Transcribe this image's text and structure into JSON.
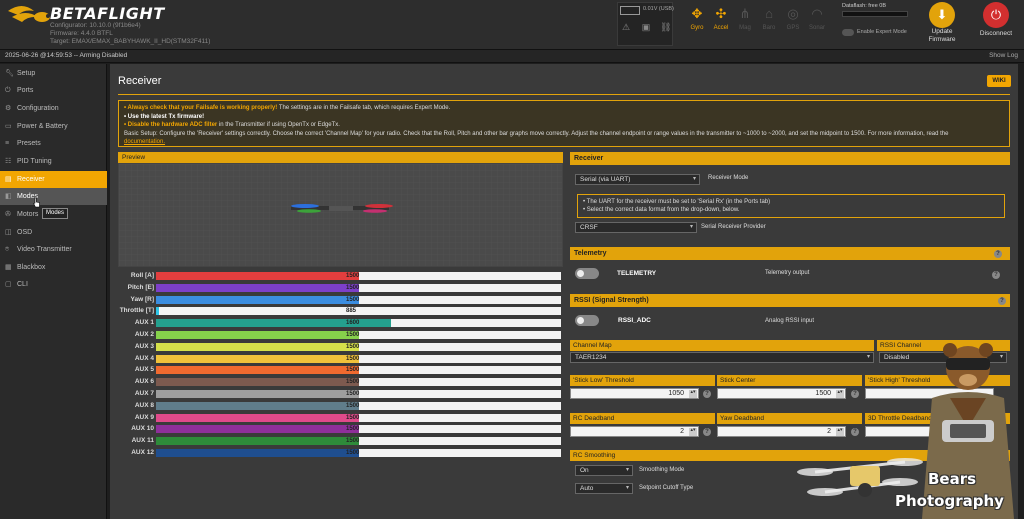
{
  "header": {
    "brand": "BETAFLIGHT",
    "configurator": "Configurator: 10.10.0 (9f1b6e4)",
    "firmware": "Firmware: 4.4.0 BTFL",
    "target": "Target: EMAX/EMAX_BABYHAWK_II_HD(STM32F411)",
    "battery_value": "0.01V (USB)",
    "sensors": [
      {
        "name": "Gyro",
        "icon": "gyro-icon",
        "active": true
      },
      {
        "name": "Accel",
        "icon": "accel-icon",
        "active": true
      },
      {
        "name": "Mag",
        "icon": "mag-icon",
        "active": false
      },
      {
        "name": "Baro",
        "icon": "baro-icon",
        "active": false
      },
      {
        "name": "GPS",
        "icon": "gps-icon",
        "active": false
      },
      {
        "name": "Sonar",
        "icon": "sonar-icon",
        "active": false
      }
    ],
    "dataflash": "Dataflash: free 0B",
    "expert_mode_label": "Enable Expert Mode",
    "update_firmware_label": "Update Firmware",
    "disconnect_label": "Disconnect"
  },
  "statusbar": {
    "text": "2025-06-26 @14:59:53 -- Arming Disabled",
    "show_log": "Show Log"
  },
  "sidebar": {
    "items": [
      {
        "label": "Setup",
        "icon": "wrench-icon"
      },
      {
        "label": "Ports",
        "icon": "plug-icon"
      },
      {
        "label": "Configuration",
        "icon": "gear-icon"
      },
      {
        "label": "Power & Battery",
        "icon": "battery-icon"
      },
      {
        "label": "Presets",
        "icon": "presets-icon"
      },
      {
        "label": "PID Tuning",
        "icon": "sliders-icon"
      },
      {
        "label": "Receiver",
        "icon": "receiver-icon"
      },
      {
        "label": "Modes",
        "icon": "modes-icon"
      },
      {
        "label": "Motors",
        "icon": "motor-icon"
      },
      {
        "label": "OSD",
        "icon": "osd-icon"
      },
      {
        "label": "Video Transmitter",
        "icon": "vtx-icon"
      },
      {
        "label": "Blackbox",
        "icon": "blackbox-icon"
      },
      {
        "label": "CLI",
        "icon": "terminal-icon"
      }
    ],
    "active": "Receiver",
    "hovered": "Modes",
    "tooltip": "Modes"
  },
  "main": {
    "title": "Receiver",
    "wiki": "WIKI",
    "note": {
      "l1_bold": "• Always check that your Failsafe is working properly!",
      "l1_rest": " The settings are in the Failsafe tab, which requires Expert Mode.",
      "l2": "• Use the latest Tx firmware!",
      "l3_bold": "• Disable the hardware ADC filter",
      "l3_rest": " in the Transmitter if using OpenTx or EdgeTx.",
      "l4": "Basic Setup: Configure the 'Receiver' settings correctly. Choose the correct 'Channel Map' for your radio. Check that the Roll, Pitch and other bar graphs move correctly. Adjust the channel endpoint or range values in the transmitter to ~1000 to ~2000, and set the midpoint to 1500. For more information, read the",
      "l5": "documentation."
    },
    "preview_title": "Preview",
    "channels": [
      {
        "name": "Roll [A]",
        "value": 1500,
        "color": "#e23e3e"
      },
      {
        "name": "Pitch [E]",
        "value": 1500,
        "color": "#7d3fc9"
      },
      {
        "name": "Yaw [R]",
        "value": 1500,
        "color": "#3b8de0"
      },
      {
        "name": "Throttle [T]",
        "value": 885,
        "color": "#2fc6e8"
      },
      {
        "name": "AUX 1",
        "value": 1600,
        "color": "#24a08e"
      },
      {
        "name": "AUX 2",
        "value": 1500,
        "color": "#86d14b"
      },
      {
        "name": "AUX 3",
        "value": 1500,
        "color": "#d5e04a"
      },
      {
        "name": "AUX 4",
        "value": 1500,
        "color": "#f0c23a"
      },
      {
        "name": "AUX 5",
        "value": 1500,
        "color": "#f06a2f"
      },
      {
        "name": "AUX 6",
        "value": 1500,
        "color": "#7d5a4f"
      },
      {
        "name": "AUX 7",
        "value": 1500,
        "color": "#9e9e9e"
      },
      {
        "name": "AUX 8",
        "value": 1500,
        "color": "#607d8b"
      },
      {
        "name": "AUX 9",
        "value": 1500,
        "color": "#e04a8a"
      },
      {
        "name": "AUX 10",
        "value": 1500,
        "color": "#8e2f9a"
      },
      {
        "name": "AUX 11",
        "value": 1500,
        "color": "#2e8b3a"
      },
      {
        "name": "AUX 12",
        "value": 1500,
        "color": "#1f4e8f"
      }
    ],
    "channel_range": [
      875,
      2125
    ],
    "receiver": {
      "title": "Receiver",
      "mode_value": "Serial (via UART)",
      "mode_label": "Receiver Mode",
      "uart_note_1": "• The UART for the receiver must be set to 'Serial Rx' (in the Ports tab)",
      "uart_note_2": "• Select the correct data format from the drop-down, below.",
      "provider_value": "CRSF",
      "provider_label": "Serial Receiver Provider"
    },
    "telemetry": {
      "title": "Telemetry",
      "toggle_label": "TELEMETRY",
      "desc": "Telemetry output"
    },
    "rssi": {
      "title": "RSSI (Signal Strength)",
      "toggle_label": "RSSI_ADC",
      "desc": "Analog RSSI input"
    },
    "channel_map": {
      "label": "Channel Map",
      "value": "TAER1234"
    },
    "rssi_channel": {
      "label": "RSSI Channel",
      "value": "Disabled"
    },
    "stick_low": {
      "label": "'Stick Low' Threshold",
      "value": "1050"
    },
    "stick_center": {
      "label": "Stick Center",
      "value": "1500"
    },
    "stick_high": {
      "label": "'Stick High' Threshold",
      "value": ""
    },
    "rc_deadband": {
      "label": "RC Deadband",
      "value": "2"
    },
    "yaw_deadband": {
      "label": "Yaw Deadband",
      "value": "2"
    },
    "throttle_deadband": {
      "label": "3D Throttle Deadband",
      "value": ""
    },
    "rc_smoothing": {
      "title": "RC Smoothing",
      "mode_value": "On",
      "mode_label": "Smoothing Mode",
      "cutoff_value": "Auto",
      "cutoff_label": "Setpoint Cutoff Type"
    }
  },
  "watermark": {
    "line1": "Bears",
    "line2": "Photography"
  },
  "colors": {
    "accent": "#e2a30b",
    "header": "#2d2d2d",
    "panel": "#3a3a3a"
  }
}
